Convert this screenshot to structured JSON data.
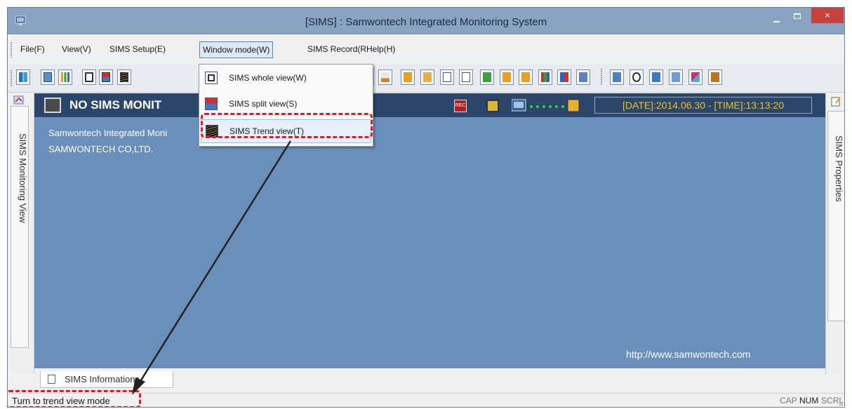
{
  "window": {
    "title": "[SIMS] : Samwontech Integrated Monitoring System",
    "close_label": "×"
  },
  "menubar": {
    "items": [
      {
        "label": "File(F)"
      },
      {
        "label": "View(V)"
      },
      {
        "label": "SIMS Setup(E)"
      },
      {
        "label": "Window mode(W)"
      },
      {
        "label": "SIMS Record(RHelp(H)"
      }
    ]
  },
  "window_mode_menu": {
    "items": [
      {
        "label": "SIMS whole view(W)",
        "icon": "whole-view-icon"
      },
      {
        "label": "SIMS split view(S)",
        "icon": "split-view-icon"
      },
      {
        "label": "SIMS Trend view(T)",
        "icon": "trend-view-icon",
        "highlighted": true
      }
    ]
  },
  "panels": {
    "left_tab": "SIMS Monitoring View",
    "right_tab": "SIMS Properties"
  },
  "monitor": {
    "title": "NO SIMS MONIT",
    "rec_label": "REC",
    "datetime": "[DATE]:2014.06.30 - [TIME]:13:13:20",
    "company_line1": "Samwontech Integrated Moni",
    "company_line2": "SAMWONTECH CO,LTD.",
    "website": "http://www.samwontech.com"
  },
  "bottom_tab": {
    "label": "SIMS Informations"
  },
  "statusbar": {
    "message": "Turn to trend view mode",
    "cap": "CAP",
    "num": "NUM",
    "scrl": "SCRL"
  },
  "colors": {
    "titlebar": "#8ba3c2",
    "close_button": "#c7423a",
    "view_background": "#6a8fba",
    "view_header": "#2b466a",
    "datetime_text": "#f0c020",
    "highlight": "#e11b23"
  }
}
